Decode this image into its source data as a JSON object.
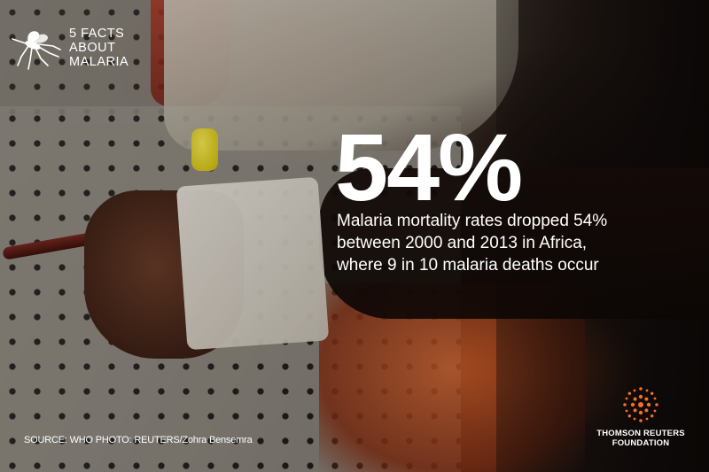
{
  "header": {
    "title_line1": "5 FACTS",
    "title_line2": "ABOUT",
    "title_line3": "MALARIA",
    "icon": "mosquito-icon"
  },
  "stat": {
    "value": "54%",
    "line1": "Malaria mortality rates dropped 54%",
    "line2": "between 2000 and 2013 in Africa,",
    "line3": "where 9 in 10 malaria deaths occur"
  },
  "credit": "SOURCE: WHO  PHOTO: REUTERS/Zohra Bensemra",
  "logo": {
    "line1": "THOMSON REUTERS",
    "line2": "FOUNDATION",
    "icon": "thomson-reuters-logo-icon",
    "accent": "#f36f21"
  },
  "colors": {
    "text": "#ffffff",
    "accent": "#f36f21"
  }
}
